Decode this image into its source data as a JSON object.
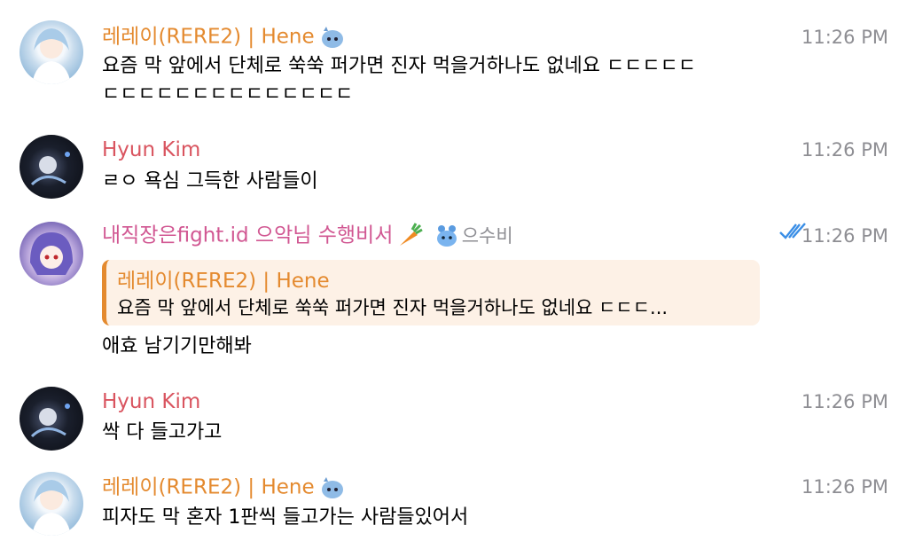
{
  "messages": [
    {
      "sender": "레레이(RERE2) | Hene",
      "time": "11:26 PM",
      "text_line1": "요즘 막 앞에서 단체로 쑥쑥 퍼가면 진자 먹을거하나도 없네요 ㄷㄷㄷㄷㄷ",
      "text_line2": "ㄷㄷㄷㄷㄷㄷㄷㄷㄷㄷㄷㄷㄷㄷ",
      "colors": {
        "name": "#e48a2f"
      }
    },
    {
      "sender": "Hyun Kim",
      "time": "11:26 PM",
      "text": "ㄹㅇ 욕심 그득한 사람들이"
    },
    {
      "sender": "내직장은fight.id 으악님 수행비서",
      "sender_tag": "으수비",
      "time": "11:26 PM",
      "reply_to": {
        "sender": "레레이(RERE2) | Hene",
        "text": "요즘 막 앞에서 단체로 쑥쑥 퍼가면 진자 먹을거하나도 없네요 ㄷㄷㄷ..."
      },
      "text": "애효 남기기만해봐",
      "status": "read"
    },
    {
      "sender": "Hyun Kim",
      "time": "11:26 PM",
      "text": "싹 다 들고가고"
    },
    {
      "sender": "레레이(RERE2) | Hene",
      "time": "11:26 PM",
      "text": "피자도 막 혼자 1판씩 들고가는 사람들있어서"
    }
  ],
  "icons": [
    "carrot-emoji",
    "blue-mascot-emoji",
    "double-check-icon"
  ],
  "accent_colors": {
    "orange": "#e48a2f",
    "red": "#d9545f",
    "pink": "#d15792",
    "reply_bg": "#fdf1e6",
    "time": "#8e8e93",
    "check": "#3a8ee6"
  }
}
